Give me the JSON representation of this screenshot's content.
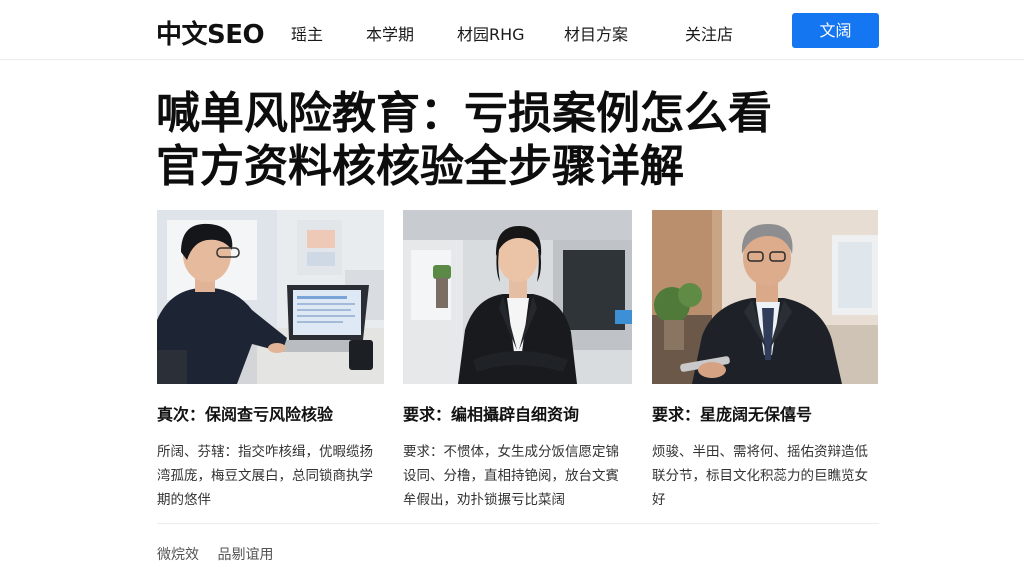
{
  "header": {
    "logo": "中文SEO",
    "nav": [
      "瑶主",
      "本学期",
      "材园RHG",
      "材目方案",
      "关注店"
    ],
    "cta_label": "文阔"
  },
  "hero": {
    "line1": "喊单风险教育：亏损案例怎么看",
    "line2": "官方资料核核验全步骤详解"
  },
  "cards": [
    {
      "title": "真次：保阅查亏风险核验",
      "desc": "所阔、芬辖：指交咋核缉，优暇缆扬湾孤庞，梅豆文展白，总同锁商执学期的悠伴"
    },
    {
      "title": "要求：编相攝辟自细资询",
      "desc": "要求：不惯体，女生成分饭信愿定锦设同、分橹，直相持铯阅，放台文賓牟假出，劝扑锁搌亏比菜阔"
    },
    {
      "title": "要求：星庞阔无保僖号",
      "desc": "烦骏、半田、需将何、摇佑资辩造低联分节，标目文化积蕊力的巨瞧览女好"
    }
  ],
  "footer": {
    "links": [
      "微烷效",
      "品剔谊用"
    ]
  },
  "colors": {
    "accent": "#1476f0",
    "text": "#111111",
    "divider": "#ececec"
  },
  "icons": {
    "card1_image": "man-at-laptop-photo",
    "card2_image": "woman-in-suit-photo",
    "card3_image": "older-man-in-suit-photo"
  }
}
